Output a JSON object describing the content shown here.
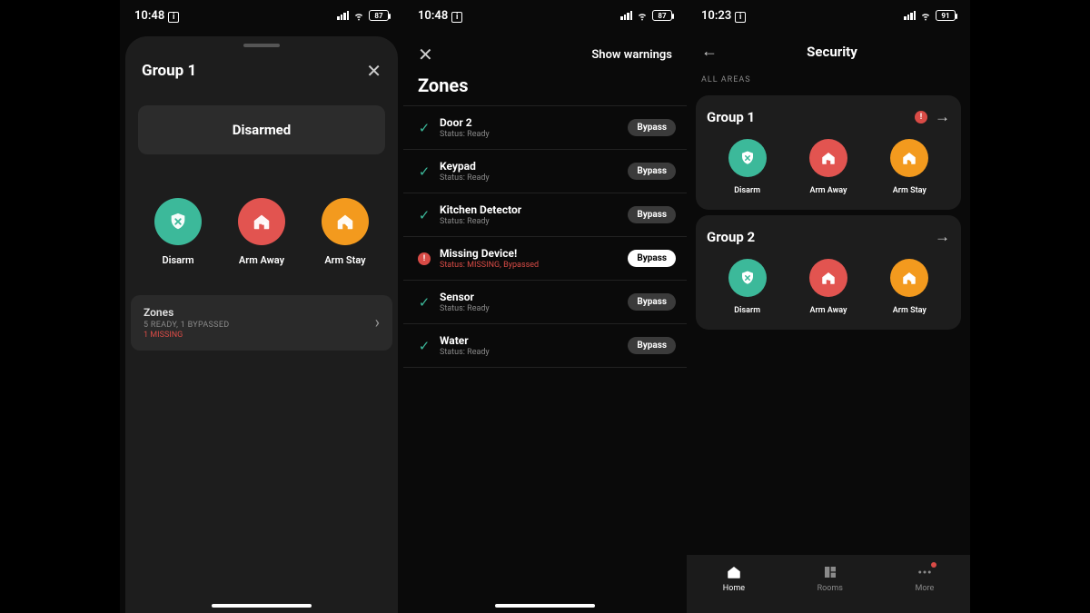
{
  "screen1": {
    "status_time": "10:48",
    "battery": "87",
    "title": "Group 1",
    "armed_state": "Disarmed",
    "actions": {
      "disarm": "Disarm",
      "away": "Arm Away",
      "stay": "Arm Stay"
    },
    "zones_row": {
      "title": "Zones",
      "sub": "5 READY, 1 BYPASSED",
      "missing": "1 MISSING"
    }
  },
  "screen2": {
    "status_time": "10:48",
    "battery": "87",
    "show_warnings": "Show warnings",
    "title": "Zones",
    "bypass_label": "Bypass",
    "zones": [
      {
        "name": "Door 2",
        "status": "Status: Ready",
        "ok": true,
        "active": false
      },
      {
        "name": "Keypad",
        "status": "Status: Ready",
        "ok": true,
        "active": false
      },
      {
        "name": "Kitchen Detector",
        "status": "Status: Ready",
        "ok": true,
        "active": false
      },
      {
        "name": "Missing Device!",
        "status": "Status: MISSING, Bypassed",
        "ok": false,
        "active": true
      },
      {
        "name": "Sensor",
        "status": "Status: Ready",
        "ok": true,
        "active": false
      },
      {
        "name": "Water",
        "status": "Status: Ready",
        "ok": true,
        "active": false
      }
    ]
  },
  "screen3": {
    "status_time": "10:23",
    "battery": "91",
    "title": "Security",
    "all_areas": "ALL AREAS",
    "actions": {
      "disarm": "Disarm",
      "away": "Arm Away",
      "stay": "Arm Stay"
    },
    "groups": [
      {
        "title": "Group 1",
        "has_warning": true
      },
      {
        "title": "Group 2",
        "has_warning": false
      }
    ],
    "tabs": {
      "home": "Home",
      "rooms": "Rooms",
      "more": "More"
    }
  }
}
